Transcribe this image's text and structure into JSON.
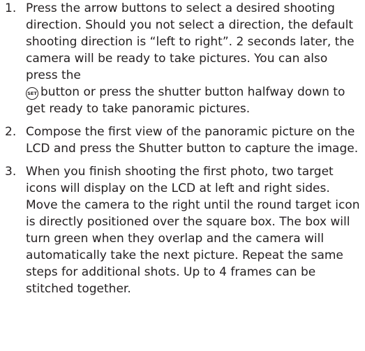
{
  "steps": [
    {
      "number": "1.",
      "text_before_icon": "Press the arrow buttons to select a desired shooting direction. Should you not select a direction, the default shooting direction is “left to right”. 2 seconds later, the camera will be ready to take pictures. You can also press the",
      "icon_label": "SET",
      "icon_name": "set-button-icon",
      "text_after_icon": "button or press the shutter button halfway down to get ready to take panoramic pictures."
    },
    {
      "number": "2.",
      "text": "Compose the first view of the panoramic picture on the LCD and press the Shutter button to capture the image."
    },
    {
      "number": "3.",
      "text": "When you finish shooting the first photo, two target icons will display on the LCD at left and right sides. Move the camera to the right until the round target icon is directly positioned over the square box. The box will turn green when they overlap and the camera will automatically take the next picture. Repeat the same steps for additional shots. Up to 4 frames can be stitched together."
    }
  ]
}
